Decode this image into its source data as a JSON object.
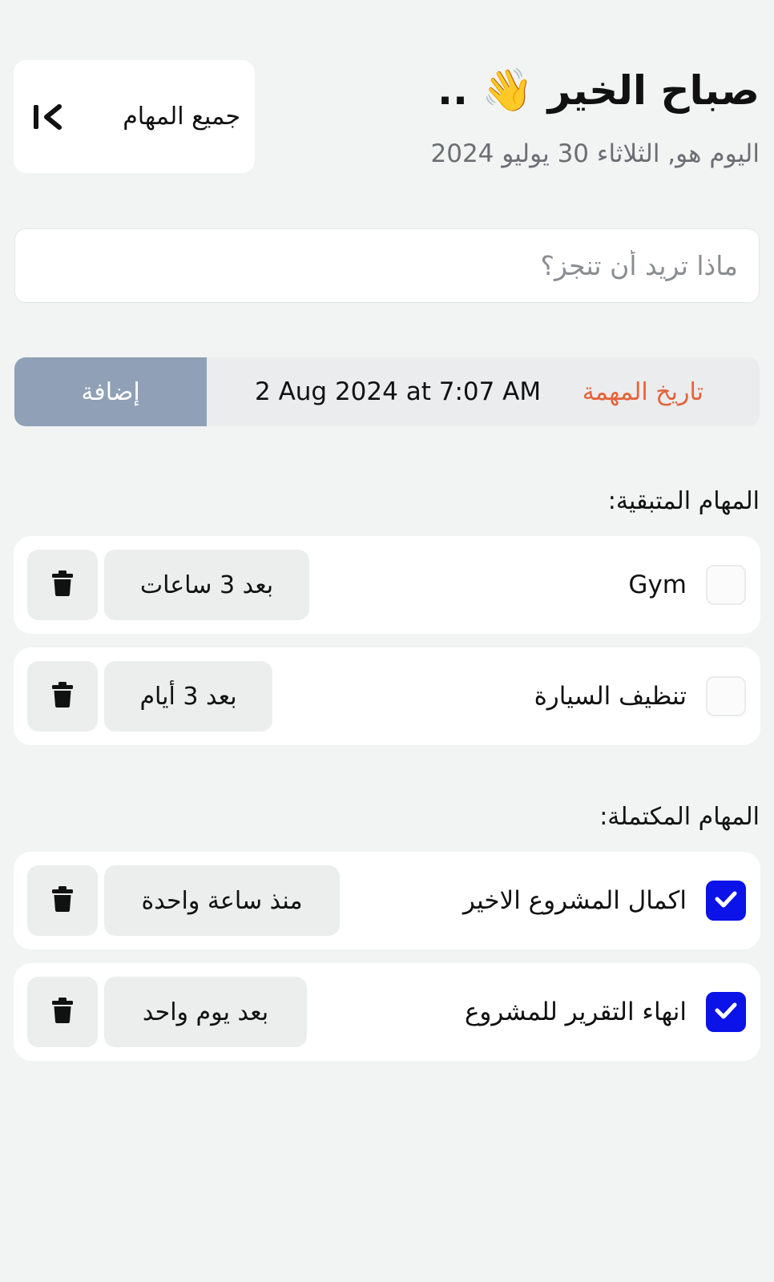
{
  "header": {
    "greeting": "صباح الخير",
    "greeting_suffix": "..",
    "wave_emoji": "👋",
    "date_text": "اليوم هو, الثلاثاء 30 يوليو 2024",
    "all_tasks_label": "جميع المهام",
    "all_tasks_icon": "collapse-left-icon"
  },
  "new_task": {
    "placeholder": "ماذا تريد أن تنجز؟",
    "value": ""
  },
  "add_bar": {
    "date_label": "تاريخ المهمة",
    "date_value": "2 Aug 2024 at 7:07 AM",
    "add_label": "إضافة"
  },
  "colors": {
    "accent_orange": "#e5623a",
    "add_button_bg": "#8fa0b7",
    "checkbox_checked": "#0b13e8",
    "background": "#f2f4f4"
  },
  "remaining": {
    "title": "المهام المتبقية:",
    "tasks": [
      {
        "title": "Gym",
        "time": "بعد 3 ساعات",
        "checked": false
      },
      {
        "title": "تنظيف السيارة",
        "time": "بعد 3 أيام",
        "checked": false
      }
    ]
  },
  "completed": {
    "title": "المهام المكتملة:",
    "tasks": [
      {
        "title": "اكمال المشروع الاخير",
        "time": "منذ ساعة واحدة",
        "checked": true
      },
      {
        "title": "انهاء التقرير للمشروع",
        "time": "بعد يوم واحد",
        "checked": true
      }
    ]
  },
  "icons": {
    "delete": "trash-icon",
    "check": "check-icon"
  }
}
